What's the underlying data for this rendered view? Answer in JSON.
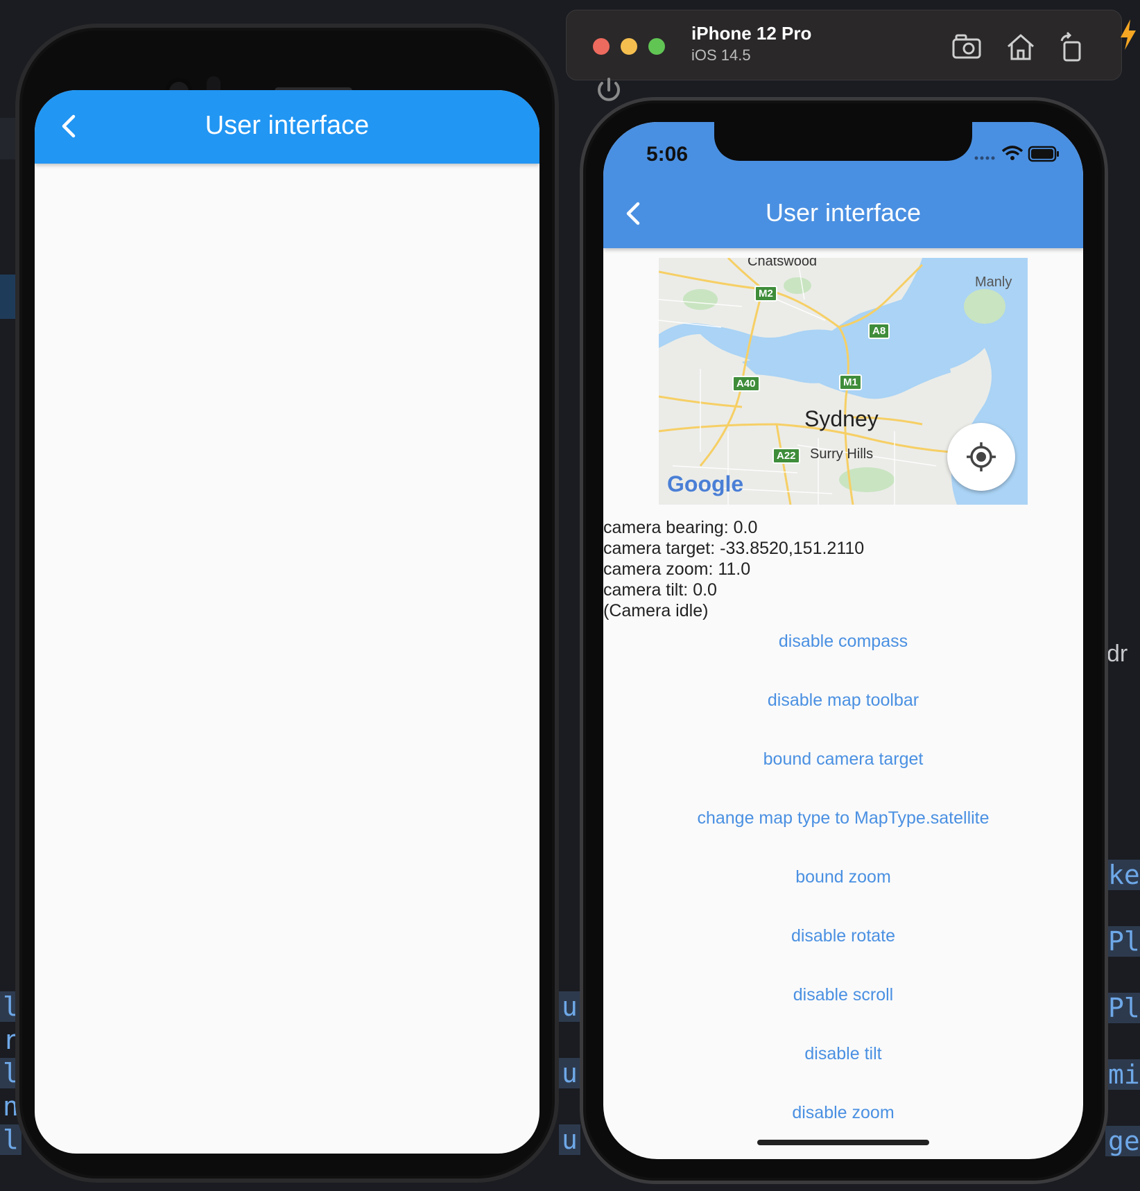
{
  "android": {
    "app_title": "User interface"
  },
  "simulator": {
    "device_name": "iPhone 12 Pro",
    "os_version": "iOS 14.5"
  },
  "ios": {
    "status_time": "5:06",
    "app_title": "User interface",
    "map": {
      "labels": {
        "chatswood": "Chatswood",
        "manly": "Manly",
        "sydney": "Sydney",
        "surry_hills": "Surry Hills"
      },
      "road_shields": {
        "m2": "M2",
        "a8": "A8",
        "a40": "A40",
        "m1": "M1",
        "a22": "A22"
      },
      "attribution": "Google"
    },
    "camera_info": {
      "bearing": "camera bearing: 0.0",
      "target": "camera target: -33.8520,151.2110",
      "zoom": "camera zoom: 11.0",
      "tilt": "camera tilt: 0.0",
      "state": "(Camera idle)"
    },
    "actions": [
      "disable compass",
      "disable map toolbar",
      "bound camera target",
      "change map type to MapType.satellite",
      "bound zoom",
      "disable rotate",
      "disable scroll",
      "disable tilt",
      "disable zoom"
    ]
  },
  "colors": {
    "android_app_bar": "#2196f3",
    "ios_header": "#4a90e2",
    "link_text": "#4a90e2",
    "water": "#aad3f5"
  }
}
